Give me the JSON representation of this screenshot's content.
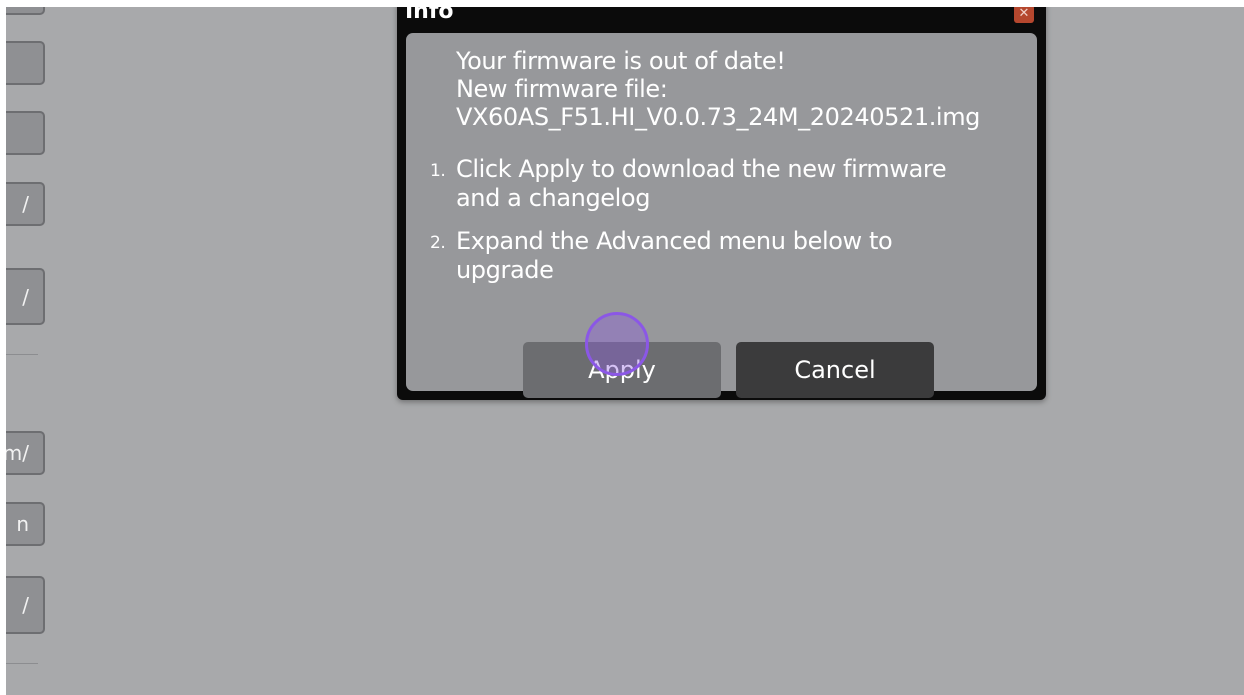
{
  "side_panel": {
    "buttons": [
      {
        "label": ""
      },
      {
        "label": ""
      },
      {
        "label": ""
      },
      {
        "label": "/"
      },
      {
        "label": "m/"
      },
      {
        "label": "n"
      },
      {
        "label": "/"
      }
    ]
  },
  "dialog": {
    "title": "Info",
    "close_icon": "close-icon",
    "message": {
      "line1": "Your firmware is out of date!",
      "line2": "New firmware file:",
      "line3": "VX60AS_F51.HI_V0.0.73_24M_20240521.img"
    },
    "steps": [
      {
        "number": "1.",
        "line1": "Click Apply to download the new firmware",
        "line2": "and a changelog"
      },
      {
        "number": "2.",
        "line1": "Expand the Advanced menu below to",
        "line2": "upgrade"
      }
    ],
    "apply_label": "Apply",
    "cancel_label": "Cancel"
  },
  "colors": {
    "backdrop": "#a8a9ab",
    "dialog_frame": "#0b0b0b",
    "dialog_body": "#97989b",
    "apply_button": "#6c6d70",
    "cancel_button": "#3b3b3c",
    "close_button": "#b5472e",
    "click_indicator": "#8b57e6"
  }
}
